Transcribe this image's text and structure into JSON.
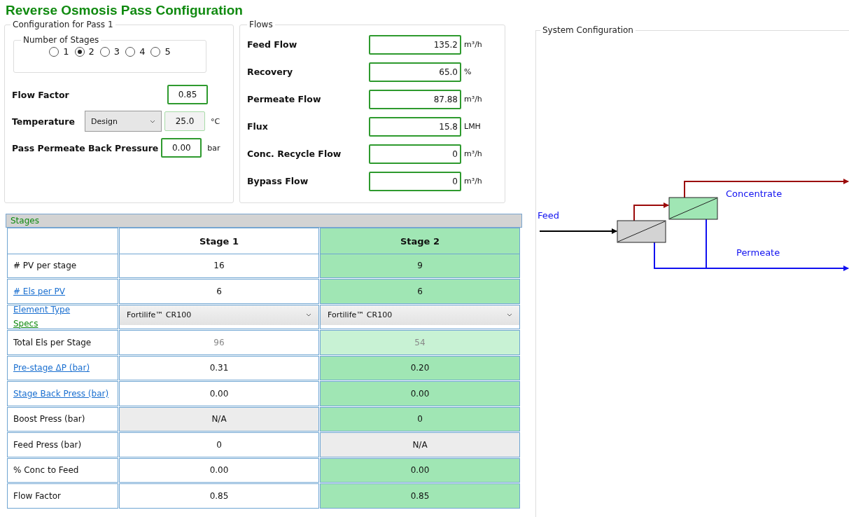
{
  "title": "Reverse Osmosis Pass Configuration",
  "config": {
    "legend": "Configuration for Pass 1",
    "stage_count": {
      "legend": "Number of Stages",
      "options": [
        {
          "label": "1",
          "selected": false
        },
        {
          "label": "2",
          "selected": true
        },
        {
          "label": "3",
          "selected": false
        },
        {
          "label": "4",
          "selected": false
        },
        {
          "label": "5",
          "selected": false
        }
      ]
    },
    "flow_factor": {
      "label": "Flow Factor",
      "value": "0.85"
    },
    "temperature": {
      "label": "Temperature",
      "mode": "Design",
      "value": "25.0",
      "unit": "°C"
    },
    "back_pressure": {
      "label": "Pass Permeate Back Pressure",
      "value": "0.00",
      "unit": "bar"
    }
  },
  "flows": {
    "legend": "Flows",
    "rows": [
      {
        "label": "Feed Flow",
        "value": "135.2",
        "unit": "m³/h"
      },
      {
        "label": "Recovery",
        "value": "65.0",
        "unit": "%"
      },
      {
        "label": "Permeate Flow",
        "value": "87.88",
        "unit": "m³/h"
      },
      {
        "label": "Flux",
        "value": "15.8",
        "unit": "LMH"
      },
      {
        "label": "Conc. Recycle Flow",
        "value": "0",
        "unit": "m³/h"
      },
      {
        "label": "Bypass Flow",
        "value": "0",
        "unit": "m³/h"
      }
    ]
  },
  "stages": {
    "title": "Stages",
    "columns": [
      {
        "name": "Stage 1",
        "selected": false
      },
      {
        "name": "Stage 2",
        "selected": true
      }
    ],
    "rows": [
      {
        "label": "# PV per stage",
        "kind": "text",
        "cells": [
          {
            "text": "16",
            "kind": "input"
          },
          {
            "text": "9",
            "kind": "input"
          }
        ]
      },
      {
        "label": "# Els per PV",
        "kind": "link",
        "cells": [
          {
            "text": "6",
            "kind": "input"
          },
          {
            "text": "6",
            "kind": "input"
          }
        ]
      },
      {
        "label": "Element Type",
        "sublabel": "Specs",
        "kind": "link",
        "cells": [
          {
            "text": "Fortilife™ CR100",
            "kind": "dropdown"
          },
          {
            "text": "Fortilife™ CR100",
            "kind": "dropdown"
          }
        ]
      },
      {
        "label": "Total Els per Stage",
        "kind": "text",
        "cells": [
          {
            "text": "96",
            "kind": "readonly"
          },
          {
            "text": "54",
            "kind": "readonly"
          }
        ]
      },
      {
        "label": "Pre-stage ΔP (bar)",
        "kind": "link",
        "cells": [
          {
            "text": "0.31",
            "kind": "input"
          },
          {
            "text": "0.20",
            "kind": "input"
          }
        ]
      },
      {
        "label": "Stage Back Press (bar)",
        "kind": "link",
        "cells": [
          {
            "text": "0.00",
            "kind": "input"
          },
          {
            "text": "0.00",
            "kind": "input"
          }
        ]
      },
      {
        "label": "Boost Press (bar)",
        "kind": "text",
        "cells": [
          {
            "text": "N/A",
            "kind": "na"
          },
          {
            "text": "0",
            "kind": "input"
          }
        ]
      },
      {
        "label": "Feed Press (bar)",
        "kind": "text",
        "cells": [
          {
            "text": "0",
            "kind": "input"
          },
          {
            "text": "N/A",
            "kind": "na"
          }
        ]
      },
      {
        "label": "% Conc to Feed",
        "kind": "text",
        "cells": [
          {
            "text": "0.00",
            "kind": "input"
          },
          {
            "text": "0.00",
            "kind": "input"
          }
        ]
      },
      {
        "label": "Flow Factor",
        "kind": "text",
        "cells": [
          {
            "text": "0.85",
            "kind": "input"
          },
          {
            "text": "0.85",
            "kind": "input"
          }
        ]
      }
    ]
  },
  "system": {
    "legend": "System Configuration",
    "feed_label": "Feed",
    "concentrate_label": "Concentrate",
    "permeate_label": "Permeate"
  }
}
